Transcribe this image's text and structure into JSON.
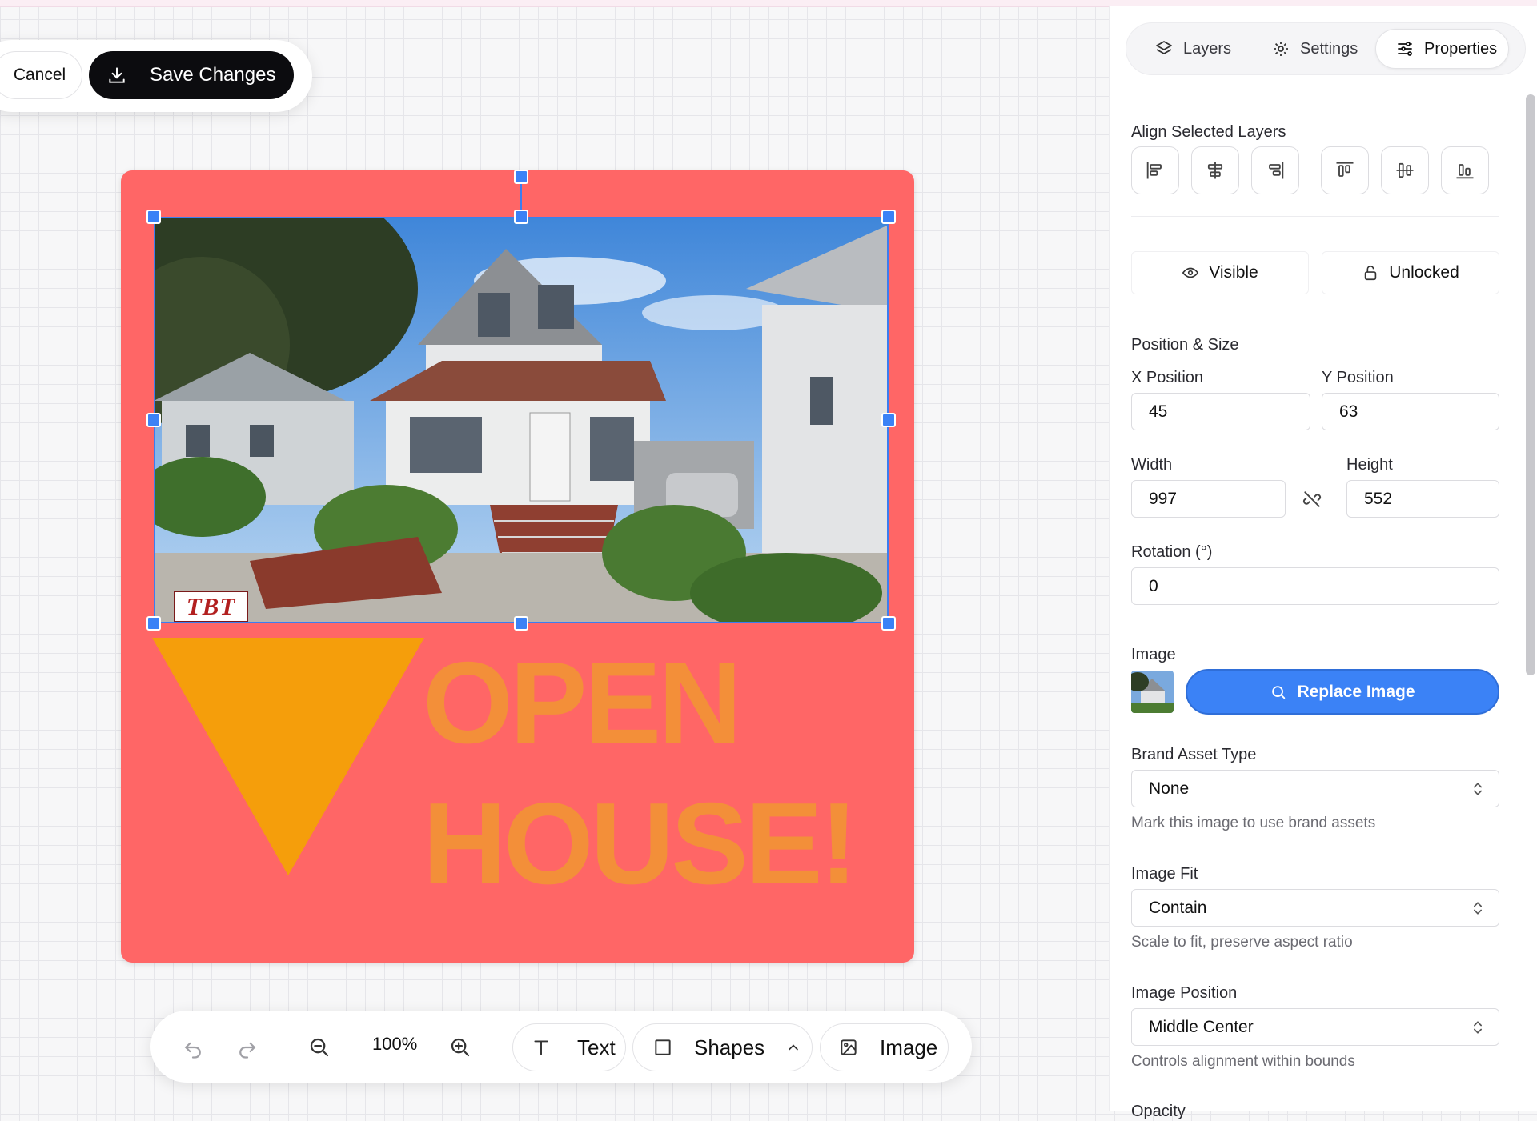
{
  "top_actions": {
    "cancel_label": "Cancel",
    "save_label": "Save Changes"
  },
  "canvas": {
    "background_color": "#ff6666",
    "headline_lines": [
      "OPEN",
      "HOUSE!"
    ],
    "headline_color": "#f39237",
    "triangle_color": "#f59e0b",
    "logo_text": "TBT"
  },
  "toolbar": {
    "zoom_label": "100%",
    "text_label": "Text",
    "shapes_label": "Shapes",
    "image_label": "Image"
  },
  "panel": {
    "tabs": [
      {
        "label": "Layers",
        "icon": "layers-icon"
      },
      {
        "label": "Settings",
        "icon": "gear-icon"
      },
      {
        "label": "Properties",
        "icon": "sliders-icon",
        "active": true
      }
    ],
    "align_title": "Align Selected Layers",
    "visible_label": "Visible",
    "locked_label": "Unlocked",
    "position_size_title": "Position & Size",
    "x_label": "X Position",
    "x_value": "45",
    "y_label": "Y Position",
    "y_value": "63",
    "width_label": "Width",
    "width_value": "997",
    "height_label": "Height",
    "height_value": "552",
    "rotation_label": "Rotation (°)",
    "rotation_value": "0",
    "image_label": "Image",
    "replace_label": "Replace Image",
    "brand_asset_label": "Brand Asset Type",
    "brand_asset_value": "None",
    "brand_asset_hint": "Mark this image to use brand assets",
    "fit_label": "Image Fit",
    "fit_value": "Contain",
    "fit_hint": "Scale to fit, preserve aspect ratio",
    "position_label": "Image Position",
    "position_value": "Middle Center",
    "position_hint": "Controls alignment within bounds",
    "opacity_label": "Opacity"
  },
  "colors": {
    "accent": "#3b82f6",
    "selection": "#3b7df0"
  }
}
